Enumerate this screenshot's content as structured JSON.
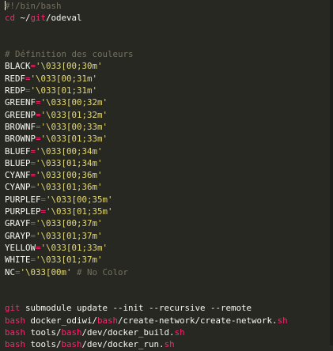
{
  "editor": {
    "lines": [
      {
        "segments": [
          {
            "text": "#!/bin/bash",
            "cls": "comment"
          }
        ]
      },
      {
        "segments": [
          {
            "text": "cd",
            "cls": "cmd"
          },
          {
            "text": " ~/",
            "cls": "plain"
          },
          {
            "text": "git",
            "cls": "cmd"
          },
          {
            "text": "/odeval",
            "cls": "plain"
          }
        ]
      },
      {
        "segments": []
      },
      {
        "segments": []
      },
      {
        "segments": [
          {
            "text": "# Définition des couleurs",
            "cls": "comment"
          }
        ]
      },
      {
        "segments": [
          {
            "text": "BLACK",
            "cls": "var"
          },
          {
            "text": "=",
            "cls": "cmd"
          },
          {
            "text": "'\\033[00;30m'",
            "cls": "str"
          }
        ]
      },
      {
        "segments": [
          {
            "text": "REDF",
            "cls": "var"
          },
          {
            "text": "=",
            "cls": "cmd"
          },
          {
            "text": "'\\033[00;31m'",
            "cls": "str"
          }
        ]
      },
      {
        "segments": [
          {
            "text": "REDP",
            "cls": "var"
          },
          {
            "text": "=",
            "cls": "cmd"
          },
          {
            "text": "'\\033[01;31m'",
            "cls": "str"
          }
        ]
      },
      {
        "segments": [
          {
            "text": "GREENF",
            "cls": "var"
          },
          {
            "text": "=",
            "cls": "cmd"
          },
          {
            "text": "'\\033[00;32m'",
            "cls": "str"
          }
        ]
      },
      {
        "segments": [
          {
            "text": "GREENP",
            "cls": "var"
          },
          {
            "text": "=",
            "cls": "cmd"
          },
          {
            "text": "'\\033[01;32m'",
            "cls": "str"
          }
        ]
      },
      {
        "segments": [
          {
            "text": "BROWNF",
            "cls": "var"
          },
          {
            "text": "=",
            "cls": "cmd"
          },
          {
            "text": "'\\033[00;33m'",
            "cls": "str"
          }
        ]
      },
      {
        "segments": [
          {
            "text": "BROWNP",
            "cls": "var"
          },
          {
            "text": "=",
            "cls": "cmd"
          },
          {
            "text": "'\\033[01;33m'",
            "cls": "str"
          }
        ]
      },
      {
        "segments": [
          {
            "text": "BLUEF",
            "cls": "var"
          },
          {
            "text": "=",
            "cls": "cmd"
          },
          {
            "text": "'\\033[00;34m'",
            "cls": "str"
          }
        ]
      },
      {
        "segments": [
          {
            "text": "BLUEP",
            "cls": "var"
          },
          {
            "text": "=",
            "cls": "cmd"
          },
          {
            "text": "'\\033[01;34m'",
            "cls": "str"
          }
        ]
      },
      {
        "segments": [
          {
            "text": "CYANF",
            "cls": "var"
          },
          {
            "text": "=",
            "cls": "cmd"
          },
          {
            "text": "'\\033[00;36m'",
            "cls": "str"
          }
        ]
      },
      {
        "segments": [
          {
            "text": "CYANP",
            "cls": "var"
          },
          {
            "text": "=",
            "cls": "cmd"
          },
          {
            "text": "'\\033[01;36m'",
            "cls": "str"
          }
        ]
      },
      {
        "segments": [
          {
            "text": "PURPLEF",
            "cls": "var"
          },
          {
            "text": "=",
            "cls": "cmd"
          },
          {
            "text": "'\\033[00;35m'",
            "cls": "str"
          }
        ]
      },
      {
        "segments": [
          {
            "text": "PURPLEP",
            "cls": "var"
          },
          {
            "text": "=",
            "cls": "cmd"
          },
          {
            "text": "'\\033[01;35m'",
            "cls": "str"
          }
        ]
      },
      {
        "segments": [
          {
            "text": "GRAYF",
            "cls": "var"
          },
          {
            "text": "=",
            "cls": "cmd"
          },
          {
            "text": "'\\033[00;37m'",
            "cls": "str"
          }
        ]
      },
      {
        "segments": [
          {
            "text": "GRAYP",
            "cls": "var"
          },
          {
            "text": "=",
            "cls": "cmd"
          },
          {
            "text": "'\\033[01;37m'",
            "cls": "str"
          }
        ]
      },
      {
        "segments": [
          {
            "text": "YELLOW",
            "cls": "var"
          },
          {
            "text": "=",
            "cls": "cmd"
          },
          {
            "text": "'\\033[01;33m'",
            "cls": "str"
          }
        ]
      },
      {
        "segments": [
          {
            "text": "WHITE",
            "cls": "var"
          },
          {
            "text": "=",
            "cls": "cmd"
          },
          {
            "text": "'\\033[01;37m'",
            "cls": "str"
          }
        ]
      },
      {
        "segments": [
          {
            "text": "NC",
            "cls": "var"
          },
          {
            "text": "=",
            "cls": "cmd"
          },
          {
            "text": "'\\033[00m'",
            "cls": "str"
          },
          {
            "text": " # No Color",
            "cls": "comment"
          }
        ]
      },
      {
        "segments": []
      },
      {
        "segments": []
      },
      {
        "segments": [
          {
            "text": "git",
            "cls": "cmd"
          },
          {
            "text": " submodule update --init --recursive --remote",
            "cls": "plain"
          }
        ]
      },
      {
        "segments": [
          {
            "text": "bash",
            "cls": "cmd"
          },
          {
            "text": " docker_odiwi/",
            "cls": "plain"
          },
          {
            "text": "bash",
            "cls": "cmd"
          },
          {
            "text": "/create-network/create-network.",
            "cls": "plain"
          },
          {
            "text": "sh",
            "cls": "cmd"
          }
        ]
      },
      {
        "segments": [
          {
            "text": "bash",
            "cls": "cmd"
          },
          {
            "text": " tools/",
            "cls": "plain"
          },
          {
            "text": "bash",
            "cls": "cmd"
          },
          {
            "text": "/dev/docker_build.",
            "cls": "plain"
          },
          {
            "text": "sh",
            "cls": "cmd"
          }
        ]
      },
      {
        "segments": [
          {
            "text": "bash",
            "cls": "cmd"
          },
          {
            "text": " tools/",
            "cls": "plain"
          },
          {
            "text": "bash",
            "cls": "cmd"
          },
          {
            "text": "/dev/docker_run.",
            "cls": "plain"
          },
          {
            "text": "sh",
            "cls": "cmd"
          }
        ]
      }
    ]
  },
  "colors": {
    "background": "#272822",
    "comment": "#75715e",
    "keyword": "#f92672",
    "string": "#e6db74",
    "plain": "#f8f8f2"
  }
}
